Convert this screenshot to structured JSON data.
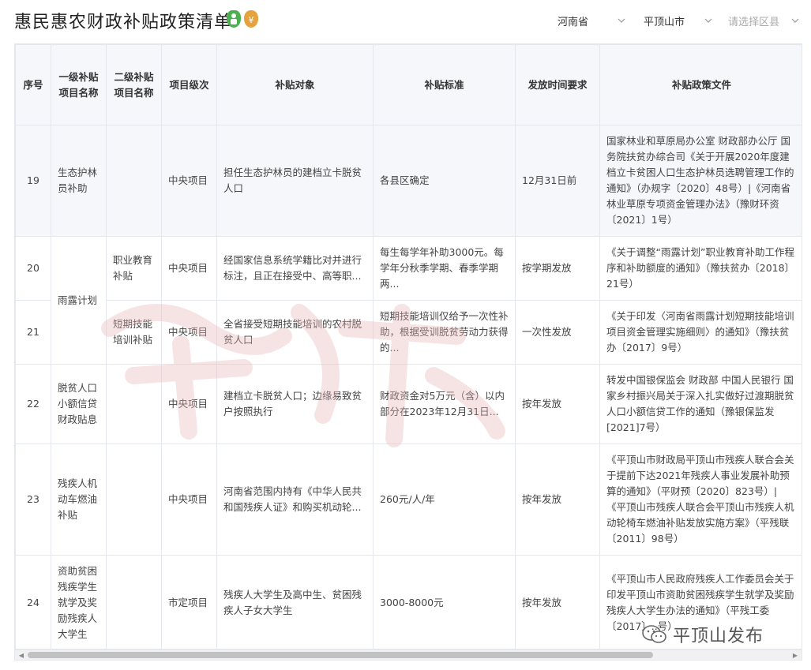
{
  "header": {
    "title": "惠民惠农财政补贴政策清单",
    "province": "河南省",
    "city": "平顶山市",
    "county_placeholder": "请选择区县"
  },
  "table": {
    "columns": [
      "序号",
      "一级补贴项目名称",
      "二级补贴项目名称",
      "项目级次",
      "补贴对象",
      "补贴标准",
      "发放时间要求",
      "补贴政策文件"
    ],
    "rows": [
      {
        "no": "19",
        "level1": "生态护林员补助",
        "level2": "",
        "tier": "中央项目",
        "target": "担任生态护林员的建档立卡脱贫人口",
        "standard": "各县区确定",
        "time": "12月31日前",
        "policy": "国家林业和草原局办公室 财政部办公厅 国务院扶贫办综合司《关于开展2020年度建档立卡贫困人口生态护林员选聘管理工作的通知》（办规字〔2020〕48号）|《河南省林业草原专项资金管理办法》（豫财环资〔2021〕1号）"
      },
      {
        "no": "20",
        "level1": "雨露计划",
        "level2": "职业教育补贴",
        "tier": "中央项目",
        "target": "经国家信息系统学籍比对并进行标注，且正在接受中、高等职...",
        "standard": "每生每学年补助3000元。每学年分秋季学期、春季学期两...",
        "time": "按学期发放",
        "policy": "《关于调整“雨露计划”职业教育补助工作程序和补助额度的通知》（豫扶贫办〔2018〕21号）"
      },
      {
        "no": "21",
        "level1": "",
        "level2": "短期技能培训补贴",
        "tier": "中央项目",
        "target": "全省接受短期技能培训的农村脱贫人口",
        "standard": "短期技能培训仅给予一次性补助，根据受训脱贫劳动力获得的...",
        "time": "一次性发放",
        "policy": "《关于印发〈河南省雨露计划短期技能培训项目资金管理实施细则〉的通知》（豫扶贫办〔2017〕9号）"
      },
      {
        "no": "22",
        "level1": "脱贫人口小额信贷财政贴息",
        "level2": "",
        "tier": "中央项目",
        "target": "建档立卡脱贫人口；边缘易致贫户按照执行",
        "standard": "财政资金对5万元（含）以内部分在2023年12月31日...",
        "time": "按年发放",
        "policy": "转发中国银保监会 财政部 中国人民银行 国家乡村振兴局关于深入扎实做好过渡期脱贫人口小额信贷工作的通知（豫银保监发[2021]7号）"
      },
      {
        "no": "23",
        "level1": "残疾人机动车燃油补贴",
        "level2": "",
        "tier": "中央项目",
        "target": "河南省范围内持有《中华人民共和国残疾人证》和购买机动轮...",
        "standard": "260元/人/年",
        "time": "按年发放",
        "policy": "《平顶山市财政局平顶山市残疾人联合会关于提前下达2021年残疾人事业发展补助预算的通知》（平财预〔2020〕823号）|《平顶山市残疾人联合会平顶山市残疾人机动轮椅车燃油补贴发放实施方案》（平残联〔2011〕98号）"
      },
      {
        "no": "24",
        "level1": "资助贫困残疾学生就学及奖励残疾人大学生",
        "level2": "",
        "tier": "市定项目",
        "target": "残疾人大学生及高中生、贫困残疾人子女大学生",
        "standard": "3000-8000元",
        "time": "按年发放",
        "policy": "《平顶山市人民政府残疾人工作委员会关于印发平顶山市资助贫困残疾学生就学及奖励残疾人大学生办法的通知》（平残工委〔2017〕..号）"
      }
    ]
  },
  "brand": {
    "text": "平顶山发布"
  },
  "colors": {
    "border": "#e4e7ed",
    "header_bg": "#f5f7fa",
    "watermark": "#e8b4b4"
  }
}
